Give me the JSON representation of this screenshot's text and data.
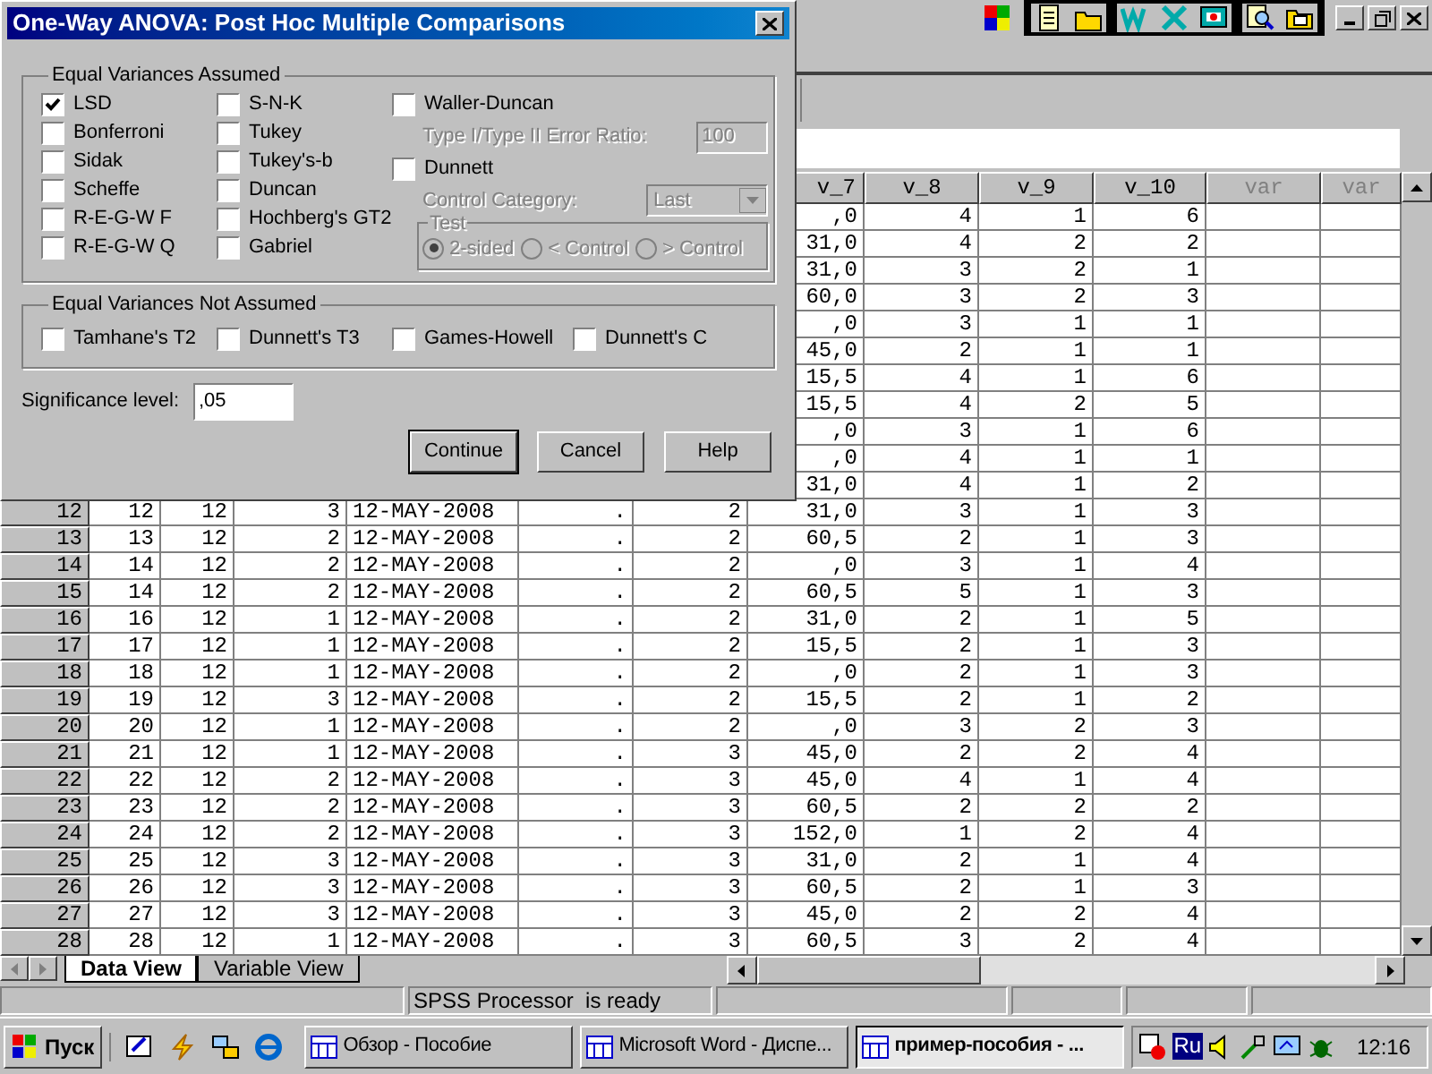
{
  "dialog": {
    "title": "One-Way ANOVA: Post Hoc Multiple Comparisons",
    "assumed": {
      "legend": "Equal Variances Assumed",
      "columns": [
        [
          {
            "label": "LSD",
            "checked": true
          },
          {
            "label": "Bonferroni",
            "checked": false
          },
          {
            "label": "Sidak",
            "checked": false
          },
          {
            "label": "Scheffe",
            "checked": false
          },
          {
            "label": "R-E-G-W F",
            "checked": false
          },
          {
            "label": "R-E-G-W Q",
            "checked": false
          }
        ],
        [
          {
            "label": "S-N-K",
            "checked": false
          },
          {
            "label": "Tukey",
            "checked": false
          },
          {
            "label": "Tukey's-b",
            "checked": false
          },
          {
            "label": "Duncan",
            "checked": false
          },
          {
            "label": "Hochberg's GT2",
            "checked": false
          },
          {
            "label": "Gabriel",
            "checked": false
          }
        ]
      ],
      "waller_duncan": {
        "label": "Waller-Duncan",
        "checked": false
      },
      "error_ratio": {
        "label": "Type I/Type II Error Ratio:",
        "value": "100",
        "disabled": true
      },
      "dunnett": {
        "label": "Dunnett",
        "checked": false
      },
      "control_category": {
        "label": "Control Category:",
        "value": "Last",
        "disabled": true
      },
      "test": {
        "legend": "Test",
        "disabled": true,
        "options": [
          {
            "label": "2-sided",
            "selected": true
          },
          {
            "label": "< Control",
            "selected": false
          },
          {
            "label": "> Control",
            "selected": false
          }
        ]
      }
    },
    "not_assumed": {
      "legend": "Equal Variances Not Assumed",
      "tests": [
        {
          "label": "Tamhane's T2",
          "checked": false
        },
        {
          "label": "Dunnett's T3",
          "checked": false
        },
        {
          "label": "Games-Howell",
          "checked": false
        },
        {
          "label": "Dunnett's C",
          "checked": false
        }
      ]
    },
    "significance": {
      "label": "Significance level:",
      "value": ",05"
    },
    "buttons": [
      {
        "label": "Continue",
        "default": true
      },
      {
        "label": "Cancel",
        "default": false
      },
      {
        "label": "Help",
        "default": false
      }
    ]
  },
  "data_editor": {
    "columns": [
      null,
      null,
      null,
      null,
      null,
      null,
      {
        "label": "v_7",
        "defined": true
      },
      {
        "label": "v_8",
        "defined": true
      },
      {
        "label": "v_9",
        "defined": true
      },
      {
        "label": "v_10",
        "defined": true
      },
      {
        "label": "var",
        "defined": false
      },
      {
        "label": "var",
        "defined": false
      }
    ],
    "rows_partial": [
      [
        ",0",
        "4",
        "1",
        "6"
      ],
      [
        "31,0",
        "4",
        "2",
        "2"
      ],
      [
        "31,0",
        "3",
        "2",
        "1"
      ],
      [
        "60,0",
        "3",
        "2",
        "3"
      ],
      [
        ",0",
        "3",
        "1",
        "1"
      ],
      [
        "45,0",
        "2",
        "1",
        "1"
      ],
      [
        "15,5",
        "4",
        "1",
        "6"
      ],
      [
        "15,5",
        "4",
        "2",
        "5"
      ],
      [
        ",0",
        "3",
        "1",
        "6"
      ],
      [
        ",0",
        "4",
        "1",
        "1"
      ],
      [
        "31,0",
        "4",
        "1",
        "2"
      ]
    ],
    "rows": [
      {
        "number": "12",
        "cells": [
          "12",
          "12",
          "3",
          "12-MAY-2008",
          ".",
          "2",
          "31,0",
          "3",
          "1",
          "3"
        ]
      },
      {
        "number": "13",
        "cells": [
          "13",
          "12",
          "2",
          "12-MAY-2008",
          ".",
          "2",
          "60,5",
          "2",
          "1",
          "3"
        ]
      },
      {
        "number": "14",
        "cells": [
          "14",
          "12",
          "2",
          "12-MAY-2008",
          ".",
          "2",
          ",0",
          "3",
          "1",
          "4"
        ]
      },
      {
        "number": "15",
        "cells": [
          "14",
          "12",
          "2",
          "12-MAY-2008",
          ".",
          "2",
          "60,5",
          "5",
          "1",
          "3"
        ]
      },
      {
        "number": "16",
        "cells": [
          "16",
          "12",
          "1",
          "12-MAY-2008",
          ".",
          "2",
          "31,0",
          "2",
          "1",
          "5"
        ]
      },
      {
        "number": "17",
        "cells": [
          "17",
          "12",
          "1",
          "12-MAY-2008",
          ".",
          "2",
          "15,5",
          "2",
          "1",
          "3"
        ]
      },
      {
        "number": "18",
        "cells": [
          "18",
          "12",
          "1",
          "12-MAY-2008",
          ".",
          "2",
          ",0",
          "2",
          "1",
          "3"
        ]
      },
      {
        "number": "19",
        "cells": [
          "19",
          "12",
          "3",
          "12-MAY-2008",
          ".",
          "2",
          "15,5",
          "2",
          "1",
          "2"
        ]
      },
      {
        "number": "20",
        "cells": [
          "20",
          "12",
          "1",
          "12-MAY-2008",
          ".",
          "2",
          ",0",
          "3",
          "2",
          "3"
        ]
      },
      {
        "number": "21",
        "cells": [
          "21",
          "12",
          "1",
          "12-MAY-2008",
          ".",
          "3",
          "45,0",
          "2",
          "2",
          "4"
        ]
      },
      {
        "number": "22",
        "cells": [
          "22",
          "12",
          "2",
          "12-MAY-2008",
          ".",
          "3",
          "45,0",
          "4",
          "1",
          "4"
        ]
      },
      {
        "number": "23",
        "cells": [
          "23",
          "12",
          "2",
          "12-MAY-2008",
          ".",
          "3",
          "60,5",
          "2",
          "2",
          "2"
        ]
      },
      {
        "number": "24",
        "cells": [
          "24",
          "12",
          "2",
          "12-MAY-2008",
          ".",
          "3",
          "152,0",
          "1",
          "2",
          "4"
        ]
      },
      {
        "number": "25",
        "cells": [
          "25",
          "12",
          "3",
          "12-MAY-2008",
          ".",
          "3",
          "31,0",
          "2",
          "1",
          "4"
        ]
      },
      {
        "number": "26",
        "cells": [
          "26",
          "12",
          "3",
          "12-MAY-2008",
          ".",
          "3",
          "60,5",
          "2",
          "1",
          "3"
        ]
      },
      {
        "number": "27",
        "cells": [
          "27",
          "12",
          "3",
          "12-MAY-2008",
          ".",
          "3",
          "45,0",
          "2",
          "2",
          "4"
        ]
      },
      {
        "number": "28",
        "cells": [
          "28",
          "12",
          "1",
          "12-MAY-2008",
          ".",
          "3",
          "60,5",
          "3",
          "2",
          "4"
        ]
      }
    ],
    "tabs": [
      {
        "label": "Data View",
        "selected": true
      },
      {
        "label": "Variable View",
        "selected": false
      }
    ],
    "status": "SPSS Processor  is ready"
  },
  "taskbar": {
    "start": "Пуск",
    "tasks": [
      {
        "label": "Обзор - Пособие",
        "selected": false
      },
      {
        "label": "Microsoft Word - Диспе...",
        "selected": false
      },
      {
        "label": "пример-пособия - ...",
        "selected": true
      }
    ],
    "language": "Ru",
    "clock": "12:16"
  }
}
